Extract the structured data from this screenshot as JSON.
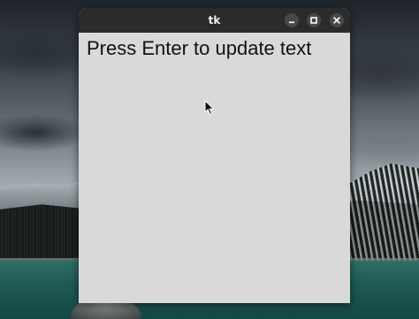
{
  "window": {
    "title": "tk",
    "controls": {
      "minimize": "minimize-icon",
      "maximize": "maximize-icon",
      "close": "close-icon"
    }
  },
  "content": {
    "label_text": "Press Enter to update text"
  },
  "colors": {
    "titlebar": "#2b2b2b",
    "window_bg": "#d9d9d9",
    "title_text": "#f0f0f0",
    "control_bg": "#484848"
  }
}
